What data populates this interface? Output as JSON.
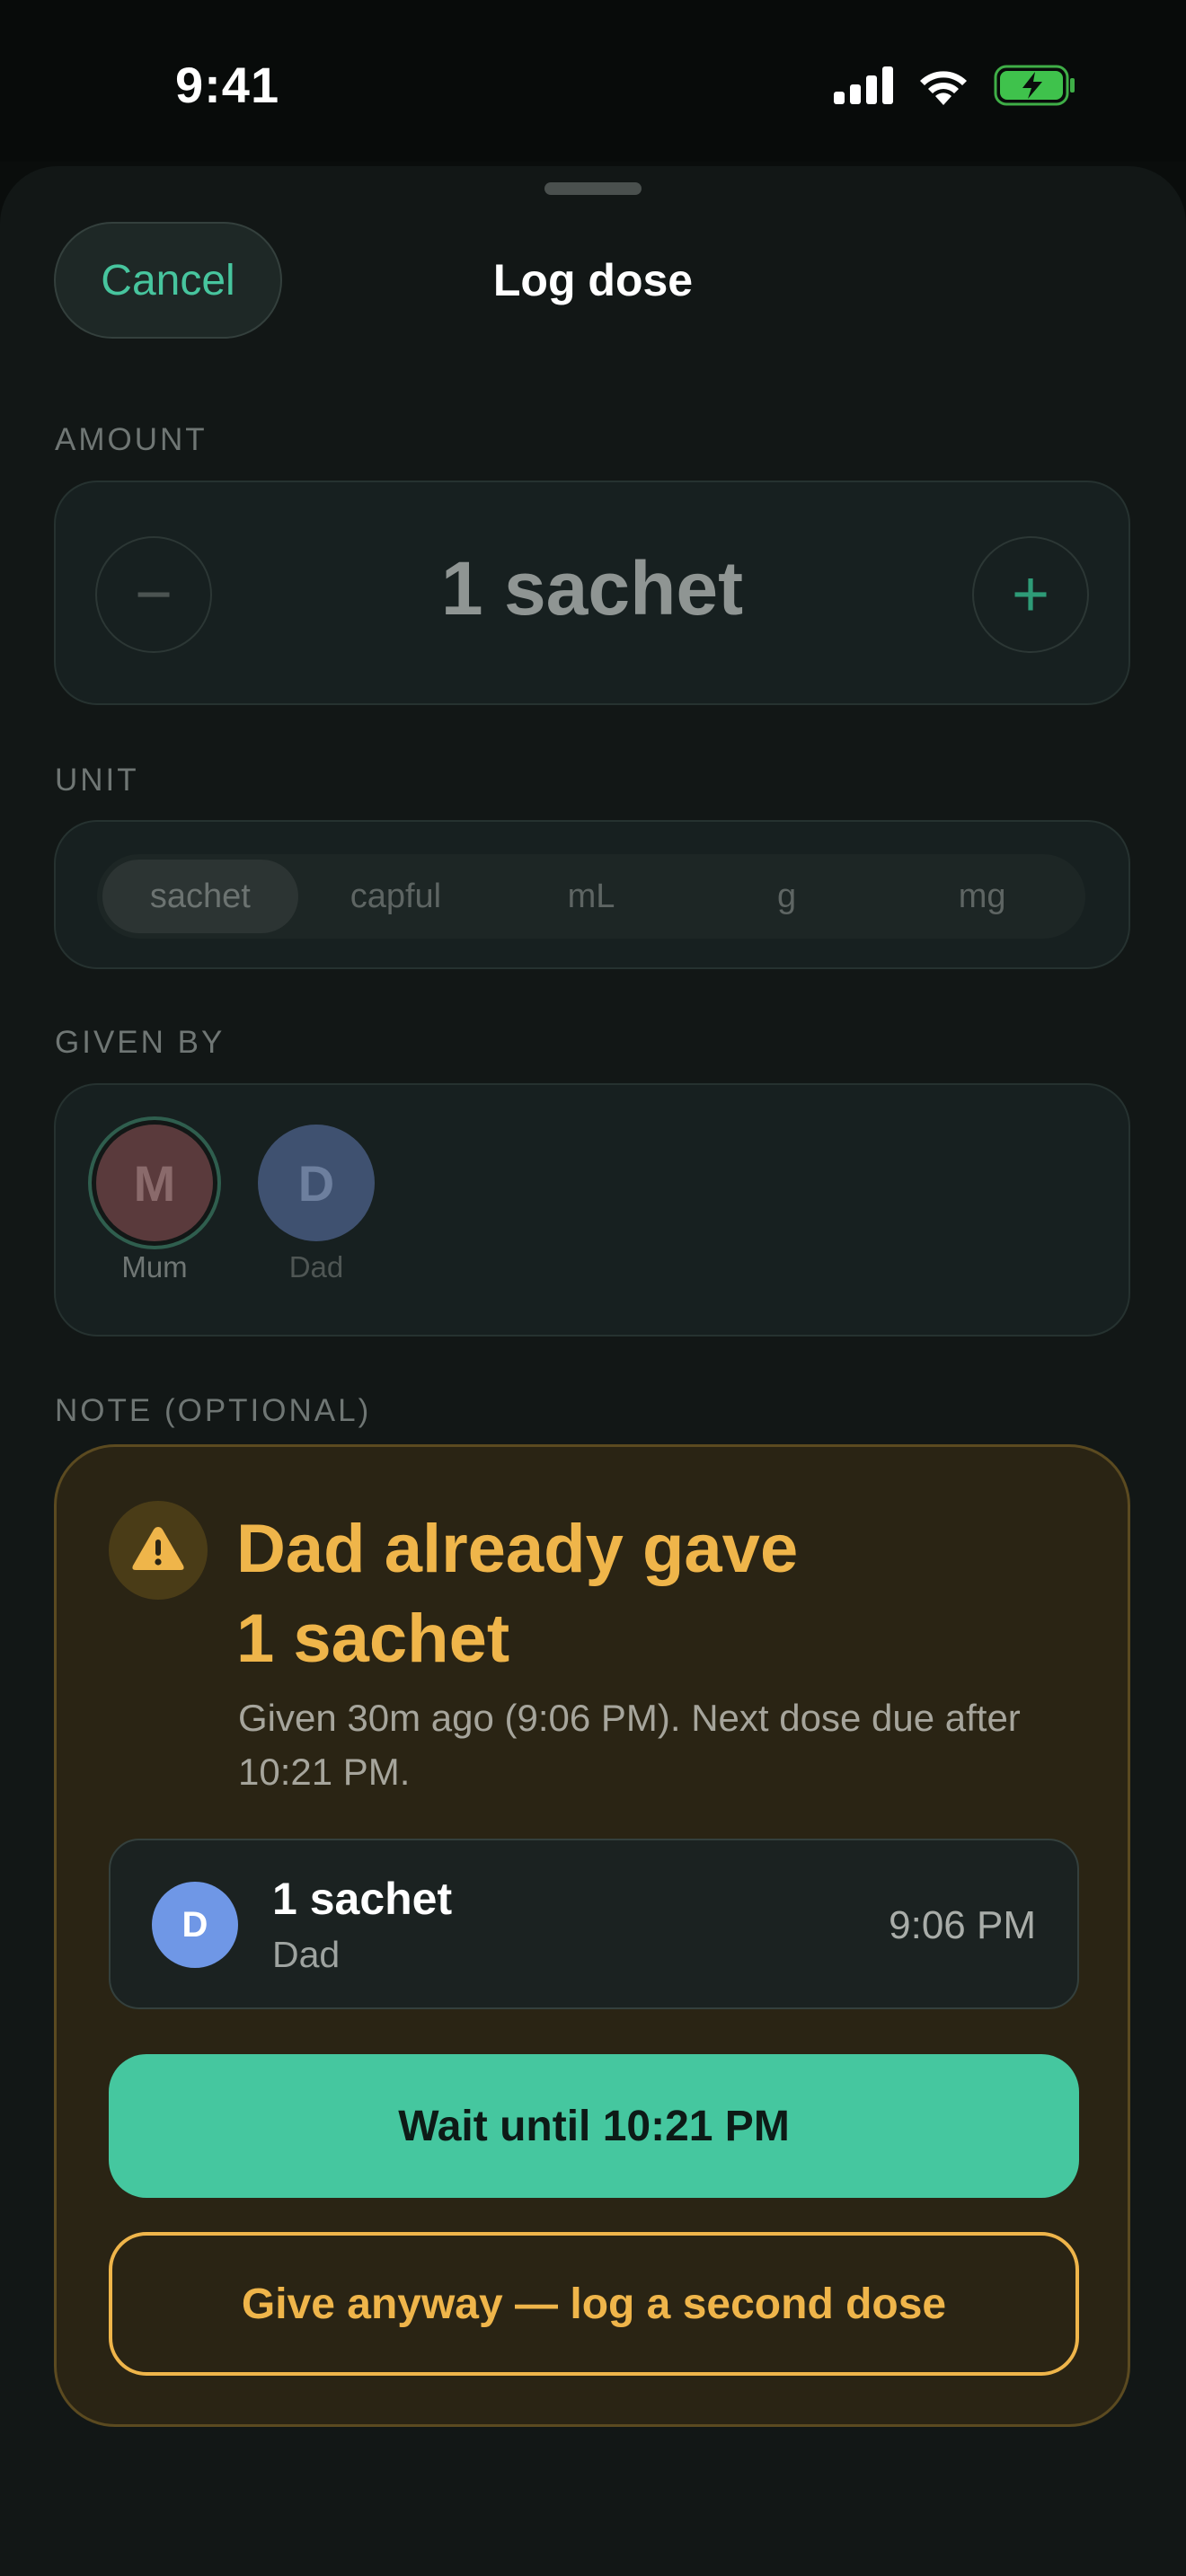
{
  "status": {
    "time": "9:41"
  },
  "sheet": {
    "title": "Log dose",
    "cancel_label": "Cancel"
  },
  "amount": {
    "label": "AMOUNT",
    "value": "1 sachet",
    "minus": "−",
    "plus": "+"
  },
  "unit": {
    "label": "UNIT",
    "options": [
      "sachet",
      "capful",
      "mL",
      "g",
      "mg"
    ],
    "selected": "sachet"
  },
  "given_by": {
    "label": "GIVEN BY",
    "people": [
      {
        "initial": "M",
        "name": "Mum",
        "selected": true
      },
      {
        "initial": "D",
        "name": "Dad",
        "selected": false
      }
    ]
  },
  "note": {
    "label": "NOTE (OPTIONAL)"
  },
  "warning": {
    "title_line1": "Dad already gave",
    "title_line2": "1 sachet",
    "subtitle": "Given 30m ago (9:06 PM). Next dose due after 10:21 PM.",
    "previous_dose": {
      "initial": "D",
      "amount": "1 sachet",
      "by": "Dad",
      "time": "9:06 PM"
    },
    "wait_label": "Wait until 10:21 PM",
    "give_anyway_label": "Give anyway — log a second dose"
  },
  "colors": {
    "accent": "#45c79f",
    "warning": "#efb54a",
    "mum_avatar": "#5a3a3c",
    "dad_avatar": "#3f5170",
    "dad_dose_avatar": "#6f97e6"
  }
}
